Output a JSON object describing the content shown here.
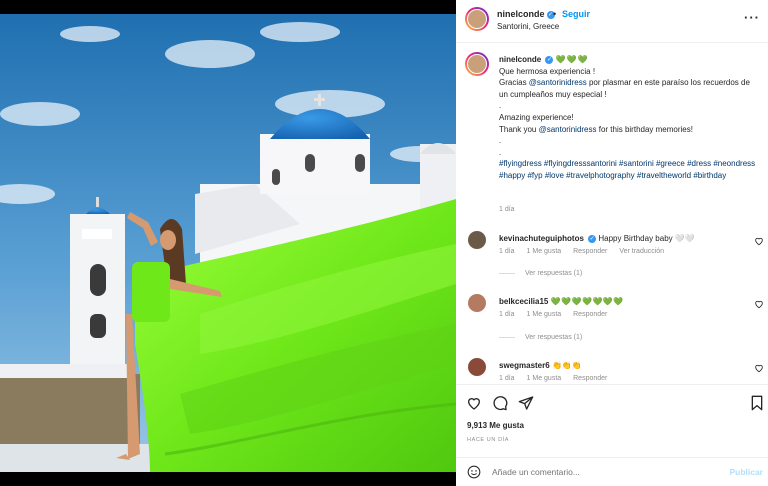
{
  "header": {
    "username": "ninelconde",
    "follow_label": "Seguir",
    "dot": "•",
    "location": "Santorini, Greece",
    "more_icon": "more-horizontal-icon"
  },
  "caption": {
    "username": "ninelconde",
    "hearts": "💚💚💚",
    "lines": [
      "Que hermosa experiencia !",
      "Gracias @santorinidress por plasmar en este paraíso los recuerdos de un cumpleaños muy especial !",
      ".",
      ".",
      "Amazing experience!",
      "Thank you @santorinidress for this birthday memories!",
      ".",
      ".",
      "#flyingdress #flyingdresssantorini #santorini #greece #dress #neondress #happy #fyp #love #travelphotography #traveltheworld #birthday"
    ],
    "time": "1 día"
  },
  "comments": [
    {
      "username": "kevinachuteguiphotos",
      "verified": true,
      "text": "Happy Birthday baby 🤍🤍",
      "time": "1 día",
      "likes": "1 Me gusta",
      "reply": "Responder",
      "translate": "Ver traducción",
      "replies": "Ver respuestas (1)"
    },
    {
      "username": "belkcecilia15",
      "verified": false,
      "text": "💚💚💚💚💚💚💚",
      "time": "1 día",
      "likes": "1 Me gusta",
      "reply": "Responder",
      "replies": "Ver respuestas (1)"
    },
    {
      "username": "swegmaster6",
      "verified": false,
      "text": "👏👏👏",
      "time": "1 día",
      "likes": "1 Me gusta",
      "reply": "Responder"
    }
  ],
  "actions": {
    "like_icon": "heart-icon",
    "comment_icon": "comment-icon",
    "share_icon": "send-icon",
    "save_icon": "bookmark-icon"
  },
  "likes_count": "9,913 Me gusta",
  "posted_ago": "HACE UN DÍA",
  "add_comment": {
    "placeholder": "Añade un comentario...",
    "publish_label": "Publicar"
  },
  "colors": {
    "accent": "#0095f6",
    "neon_dress": "#7ef21c",
    "dome_blue": "#1e78c8",
    "sky": "#2f7fb8"
  }
}
